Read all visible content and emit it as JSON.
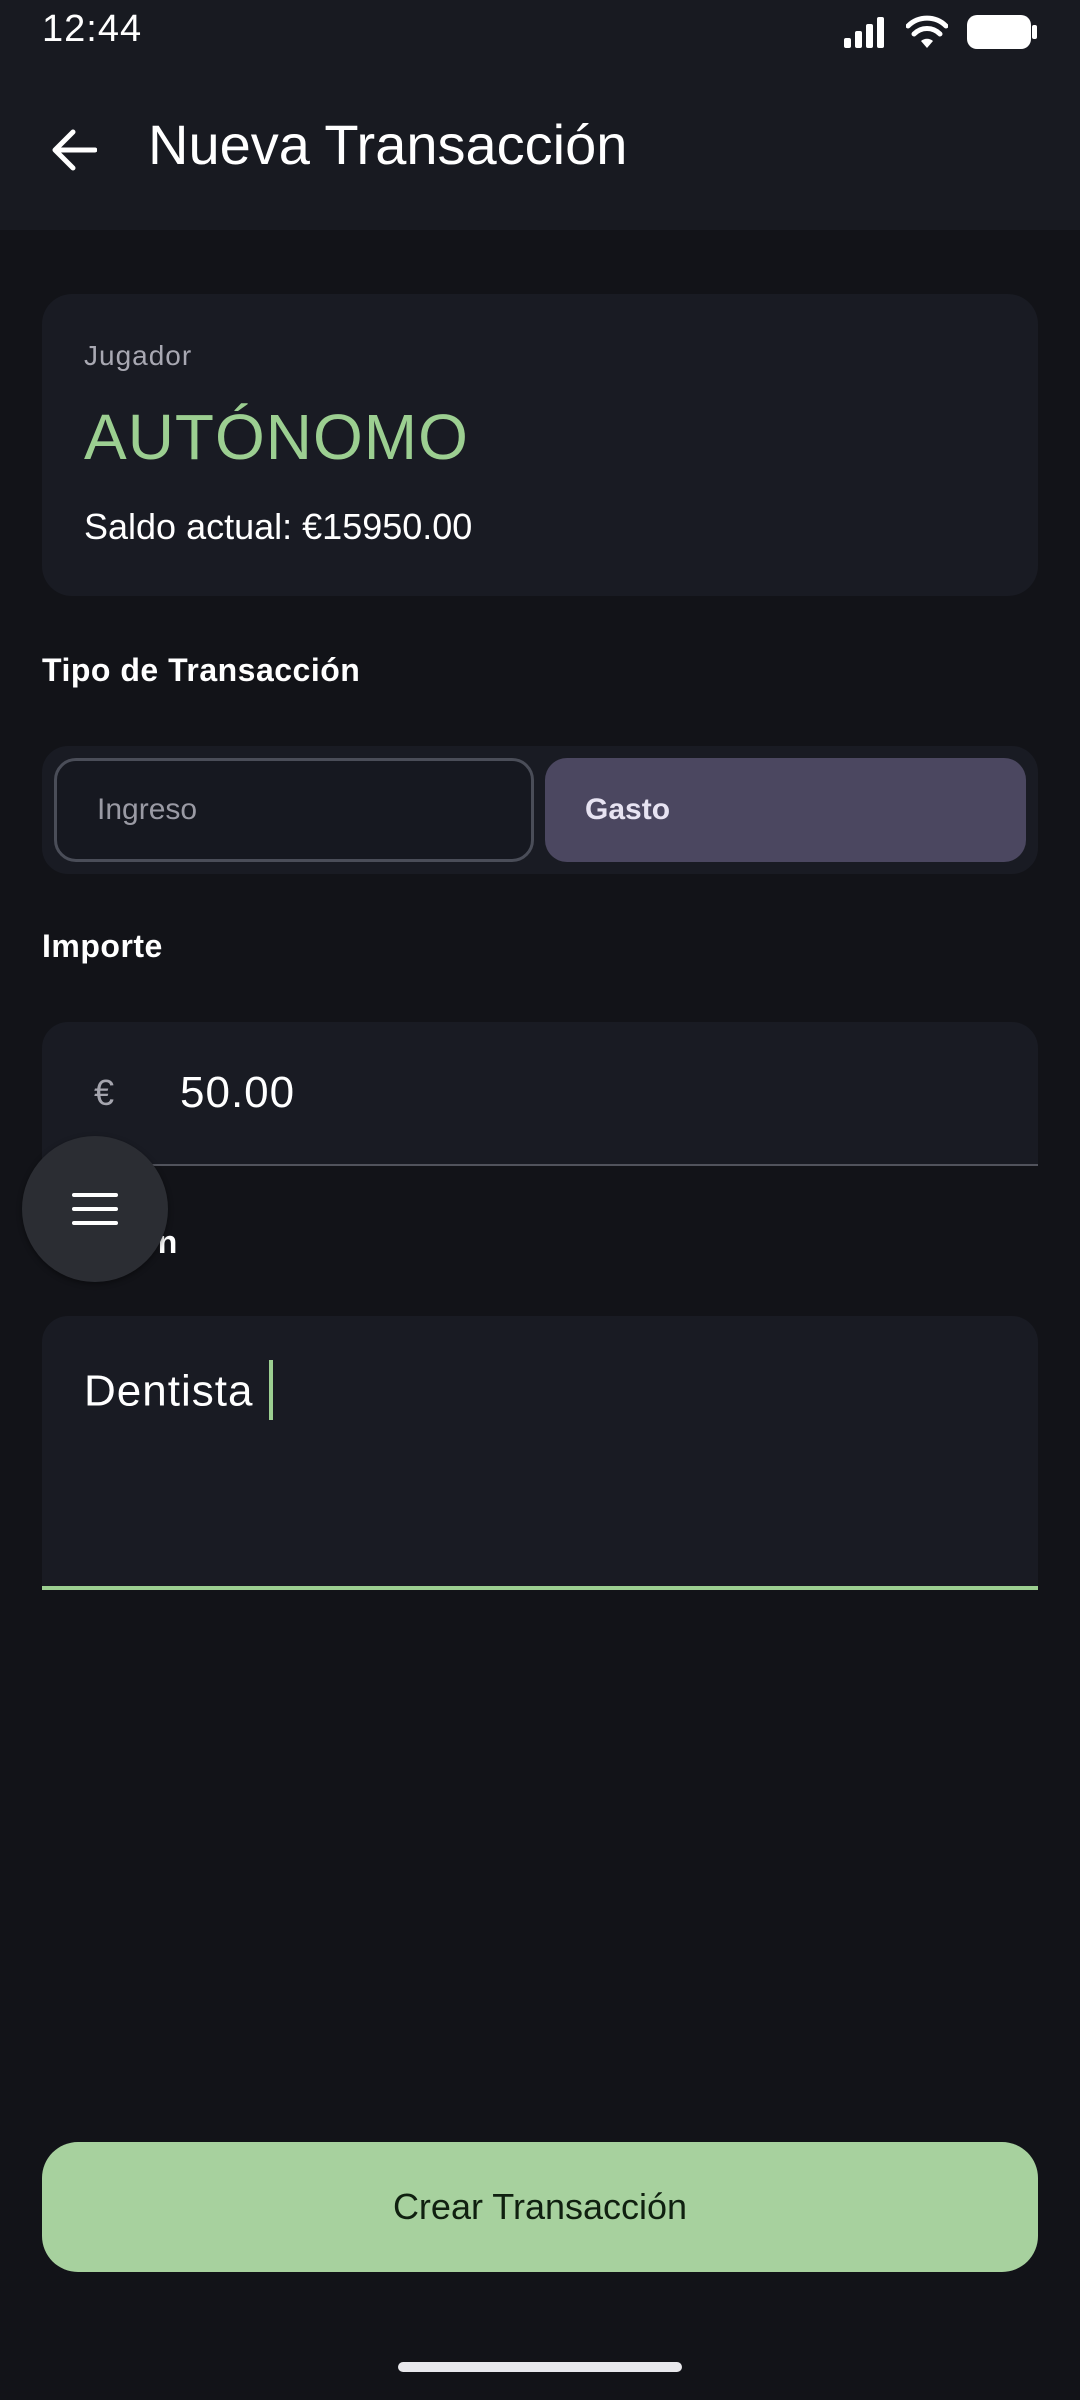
{
  "status_bar": {
    "time": "12:44"
  },
  "app_bar": {
    "title": "Nueva Transacción",
    "back_icon": "arrow-back-icon"
  },
  "player": {
    "label": "Jugador",
    "name": "AUTÓNOMO",
    "balance": "Saldo actual: €15950.00"
  },
  "transaction_type": {
    "label": "Tipo de Transacción",
    "options": [
      "Ingreso",
      "Gasto"
    ],
    "selected": "Gasto"
  },
  "amount": {
    "label": "Importe",
    "currency": "€",
    "value": "50.00"
  },
  "description": {
    "label_partial": "ción",
    "value": "Dentista"
  },
  "floating_menu": {
    "icon": "menu-icon"
  },
  "actions": {
    "create_label": "Crear Transacción"
  },
  "colors": {
    "accent": "#9ccf91",
    "button_bg": "#a7d19e",
    "selected_segment": "#4b4760",
    "background": "#121318"
  }
}
